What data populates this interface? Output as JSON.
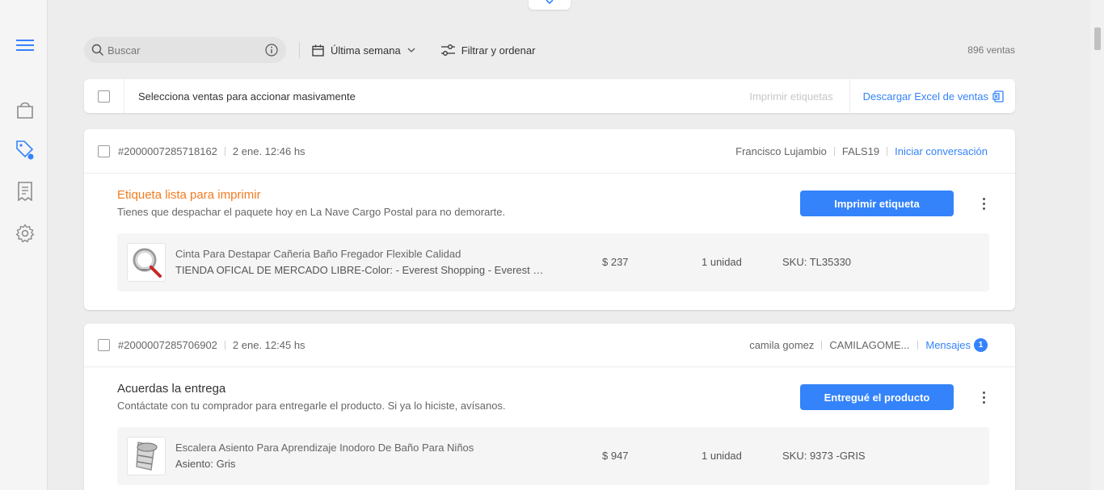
{
  "search": {
    "placeholder": "Buscar"
  },
  "toolbar": {
    "period_label": "Última semana",
    "filter_label": "Filtrar y ordenar",
    "sales_count": "896 ventas"
  },
  "bulk": {
    "select_text": "Selecciona ventas para accionar masivamente",
    "print_labels": "Imprimir etiquetas",
    "download_excel": "Descargar Excel de ventas"
  },
  "orders": [
    {
      "id": "#2000007285718162",
      "date": "2 ene. 12:46 hs",
      "buyer_name": "Francisco Lujambio",
      "buyer_nick": "FALS19",
      "contact_label": "Iniciar conversación",
      "status_title": "Etiqueta lista para imprimir",
      "status_color": "#f37b20",
      "status_sub": "Tienes que despachar el paquete hoy en La Nave Cargo Postal para no demorarte.",
      "action_label": "Imprimir etiqueta",
      "item": {
        "title": "Cinta Para Destapar Cañeria Baño Fregador Flexible Calidad",
        "subtitle": "TIENDA OFICAL DE MERCADO LIBRE-Color: - Everest Shopping - Everest Shopping",
        "price": "$ 237",
        "quantity": "1 unidad",
        "sku": "SKU: TL35330"
      }
    },
    {
      "id": "#2000007285706902",
      "date": "2 ene. 12:45 hs",
      "buyer_name": "camila gomez",
      "buyer_nick": "CAMILAGOME...",
      "contact_label": "Mensajes",
      "badge": "1",
      "status_title": "Acuerdas la entrega",
      "status_color": "#333333",
      "status_sub": "Contáctate con tu comprador para entregarle el producto. Si ya lo hiciste, avísanos.",
      "action_label": "Entregué el producto",
      "item": {
        "title": "Escalera Asiento Para Aprendizaje Inodoro De Baño Para Niños",
        "subtitle": "Asiento: Gris",
        "price": "$ 947",
        "quantity": "1 unidad",
        "sku": "SKU: 9373 -GRIS"
      }
    }
  ],
  "colors": {
    "accent": "#3483fa",
    "warning": "#f37b20"
  }
}
